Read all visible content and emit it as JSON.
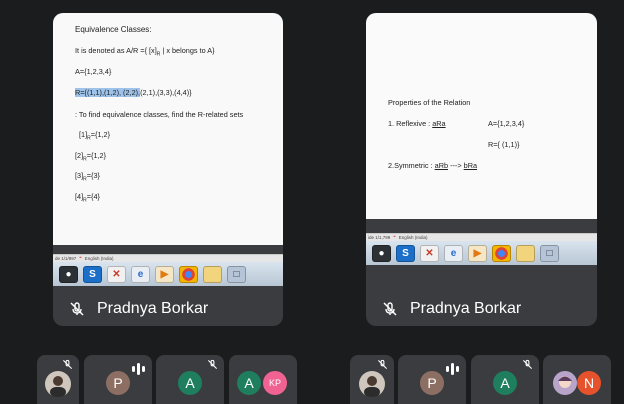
{
  "left_tile": {
    "slide_lines": [
      "Equivalence Classes:",
      "It is denoted as  A/R ={ [x]",
      "R",
      "|  x belongs to A}",
      "A={1,2,3,4}",
      "R={(1,1),(1,2), (2,2),",
      "(2,1),(3,3),(4,4)}",
      ": To find equivalence classes, find the R-related sets",
      "[1]",
      "R",
      "={1,2}",
      "[2]",
      "R",
      "={1,2}",
      "[3]",
      "R",
      "={3}",
      "[4]",
      "R",
      "={4}"
    ],
    "status_text": "de 1/1/997",
    "status_lang": "English (India)",
    "participant_name": "Pradnya Borkar"
  },
  "right_tile": {
    "slide_lines": [
      "Properties of the Relation",
      "1. Reflexive :",
      "aRa",
      "A={1,2,3,4}",
      "R={ (1,1)}",
      "2.Symmetric :",
      "aRb",
      "---> ",
      "bRa"
    ],
    "status_text": "ide 1/1,799",
    "status_lang": "English (India)",
    "participant_name": "Pradnya Borkar"
  },
  "thumbnails": [
    {
      "initial": "",
      "type": "photo",
      "muted": true
    },
    {
      "initial": "P",
      "color": "#8d6e63",
      "speaking": true
    },
    {
      "initial": "A",
      "color": "#1e7e5e",
      "muted": true
    },
    {
      "initial": "A",
      "color": "#1e7e5e",
      "extra_initial": "KP",
      "extra_color": "#f06292"
    },
    {
      "initial": "",
      "type": "photo",
      "muted": true
    },
    {
      "initial": "P",
      "color": "#8d6e63",
      "speaking": true
    },
    {
      "initial": "A",
      "color": "#1e7e5e",
      "muted": true
    },
    {
      "initial": "N",
      "color": "#e6522c",
      "type": "photo-plus"
    }
  ],
  "icons": {
    "mic_off": "mic-off-icon",
    "taskbar": [
      "camera-icon",
      "skype-icon",
      "x-app-icon",
      "ie-icon",
      "media-player-icon",
      "chrome-icon",
      "folder-icon",
      "window-icon"
    ]
  }
}
